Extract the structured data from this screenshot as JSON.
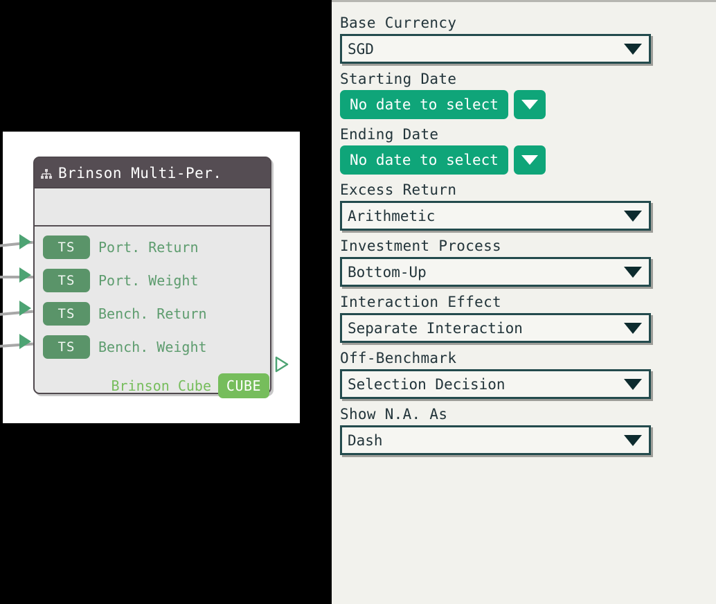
{
  "canvas": {
    "node": {
      "title": "Brinson Multi-Per.",
      "header_icon": "sitemap-icon",
      "inputs": [
        {
          "badge": "TS",
          "label": "Port. Return"
        },
        {
          "badge": "TS",
          "label": "Port. Weight"
        },
        {
          "badge": "TS",
          "label": "Bench. Return"
        },
        {
          "badge": "TS",
          "label": "Bench. Weight"
        }
      ],
      "output": {
        "label": "Brinson Cube",
        "badge": "CUBE"
      },
      "colors": {
        "header_bg": "#554d53",
        "body_bg": "#e8e8e8",
        "input_badge": "#5a9469",
        "input_label": "#5d9c6e",
        "output_badge": "#76bd5c",
        "output_label": "#76bd5c",
        "port_arrow": "#4da373",
        "edge_line": "#a7a7a7"
      }
    },
    "background": "#ffffff"
  },
  "panel": {
    "background": "#f2f2ed",
    "accent_green": "#0fa579",
    "select_border": "#234b4d",
    "label_color": "#22343a",
    "fields": [
      {
        "label": "Base Currency",
        "type": "select",
        "value": "SGD"
      },
      {
        "label": "Starting Date",
        "type": "date",
        "value": "No date to select"
      },
      {
        "label": "Ending Date",
        "type": "date",
        "value": "No date to select"
      },
      {
        "label": "Excess Return",
        "type": "select",
        "value": "Arithmetic"
      },
      {
        "label": "Investment Process",
        "type": "select",
        "value": "Bottom-Up"
      },
      {
        "label": "Interaction Effect",
        "type": "select",
        "value": "Separate Interaction"
      },
      {
        "label": "Off-Benchmark",
        "type": "select",
        "value": "Selection Decision"
      },
      {
        "label": "Show N.A. As",
        "type": "select",
        "value": "Dash"
      }
    ]
  }
}
